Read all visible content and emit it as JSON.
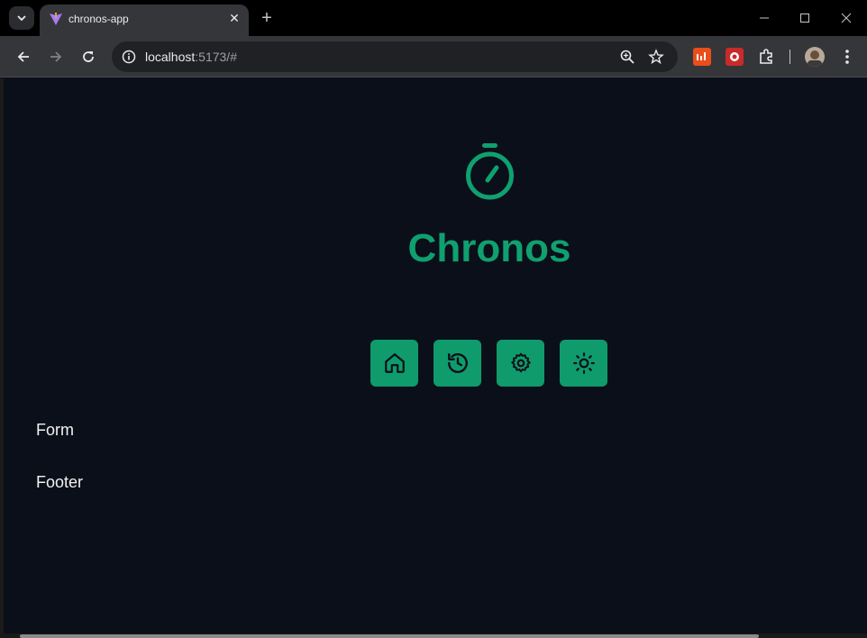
{
  "browser": {
    "tab_title": "chronos-app",
    "url_host": "localhost",
    "url_rest": ":5173/#"
  },
  "app": {
    "brand": "Chronos",
    "nav": [
      {
        "icon": "home-icon"
      },
      {
        "icon": "history-icon"
      },
      {
        "icon": "settings-gear-icon"
      },
      {
        "icon": "sun-theme-icon"
      }
    ],
    "sections": {
      "form": "Form",
      "footer": "Footer"
    }
  },
  "colors": {
    "accent": "#10a070",
    "button": "#0f9b6b",
    "background": "#0b0f19"
  }
}
